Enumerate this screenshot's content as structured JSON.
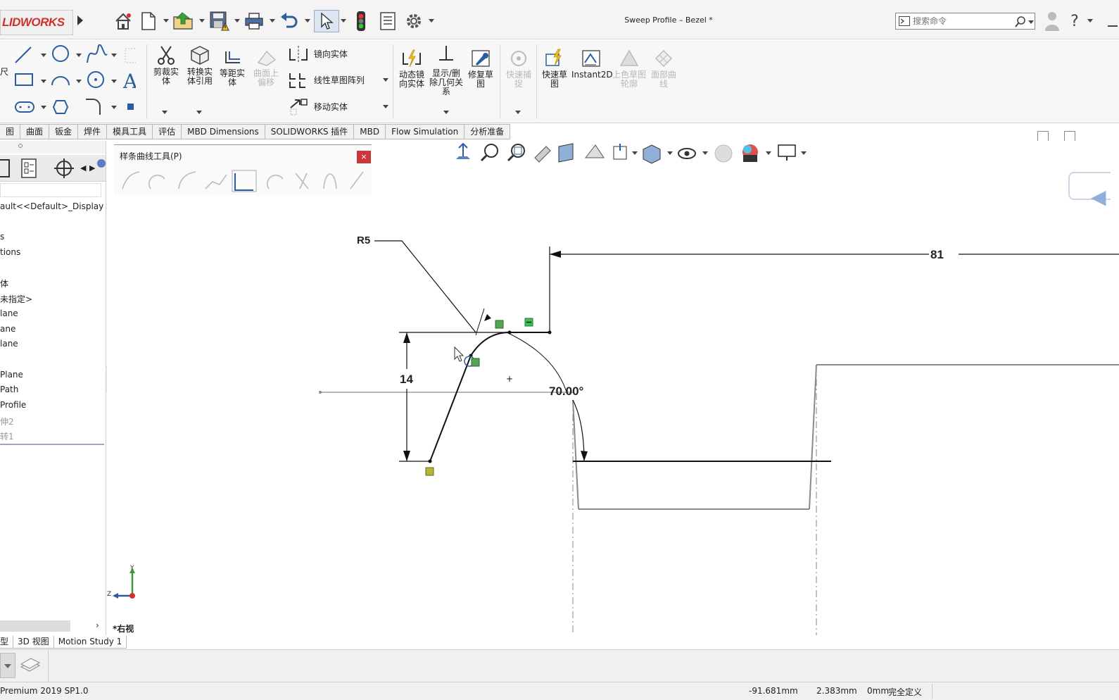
{
  "app": {
    "logo_text": "LIDWORKS",
    "document_title": "Sweep Profile – Bezel *"
  },
  "search": {
    "placeholder": "搜索命令"
  },
  "ribbon": {
    "trim": "剪裁实体",
    "convert": "转换实体引用",
    "offset": "等距实体",
    "surface_offset": "曲面上偏移",
    "mirror": "镜向实体",
    "linear_pattern": "线性草图阵列",
    "move": "移动实体",
    "dynamic_mirror": "动态镜向实体",
    "show_delete_relations": "显示/删除几何关系",
    "repair_sketch": "修复草图",
    "quick_snap": "快速捕捉",
    "rapid_sketch": "快速草图",
    "instant2d": "Instant2D",
    "shaded_contours": "上色草图轮廓",
    "face_curves": "面部曲线",
    "side_fragment_1": "图",
    "side_fragment_2": "尺"
  },
  "tabs": [
    "图",
    "曲面",
    "钣金",
    "焊件",
    "模具工具",
    "评估",
    "MBD Dimensions",
    "SOLIDWORKS 插件",
    "MBD",
    "Flow Simulation",
    "分析准备"
  ],
  "left_panel": {
    "display_state": "ault<<Default>_Display St",
    "items": [
      {
        "label": "s",
        "dim": false
      },
      {
        "label": "tions",
        "dim": false
      },
      {
        "label": "体",
        "dim": false
      },
      {
        "label": "未指定>",
        "dim": false
      },
      {
        "label": "lane",
        "dim": false
      },
      {
        "label": "ane",
        "dim": false
      },
      {
        "label": "lane",
        "dim": false
      },
      {
        "label": "Plane",
        "dim": false
      },
      {
        "label": "Path",
        "dim": false
      },
      {
        "label": "Profile",
        "dim": false
      },
      {
        "label": "伸2",
        "dim": true
      },
      {
        "label": "转1",
        "dim": true
      }
    ]
  },
  "spline_toolbar": {
    "title": "样条曲线工具(P)",
    "close": "×"
  },
  "sketch": {
    "radius_dim": "R5",
    "length_dim": "81",
    "height_dim": "14",
    "angle_dim": "70.00°"
  },
  "triad": {
    "y": "Y",
    "z": "Z"
  },
  "view_label": "*右视",
  "bottom_tabs": [
    "型",
    "3D 视图",
    "Motion Study 1"
  ],
  "status": {
    "version": "Premium 2019 SP1.0",
    "x": "-91.681mm",
    "y": "2.383mm",
    "z": "0mm",
    "state": "完全定义"
  }
}
